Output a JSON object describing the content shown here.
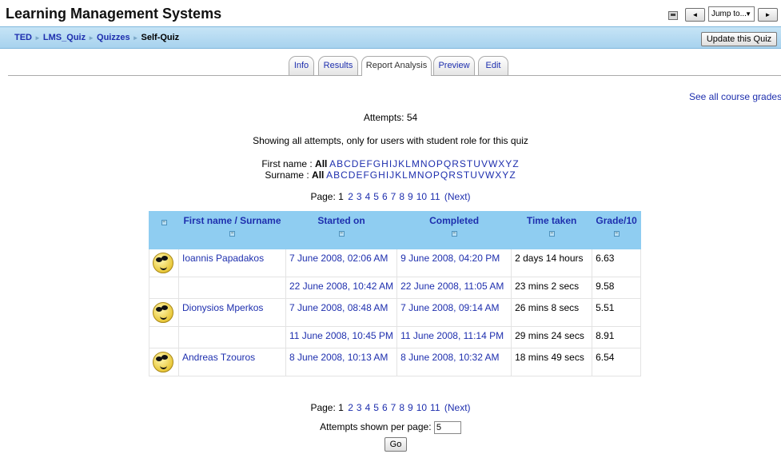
{
  "header": {
    "site_title": "Learning Management Systems",
    "jump_to": "Jump to...",
    "prev_label": "◄",
    "next_label": "►"
  },
  "breadcrumb": {
    "items": [
      "TED",
      "LMS_Quiz",
      "Quizzes"
    ],
    "current": "Self-Quiz"
  },
  "update_button": "Update this Quiz",
  "tabs": [
    {
      "label": "Info",
      "active": false
    },
    {
      "label": "Results",
      "active": false
    },
    {
      "label": "Report Analysis",
      "active": true
    },
    {
      "label": "Preview",
      "active": false
    },
    {
      "label": "Edit",
      "active": false
    }
  ],
  "see_all_link": "See all course grades",
  "attempts_text": "Attempts: 54",
  "showing_text": "Showing all attempts, only for users with student role for this quiz",
  "filters": {
    "first_name_label": "First name :",
    "surname_label": "Surname :",
    "all_label": "All",
    "letters": [
      "A",
      "B",
      "C",
      "D",
      "E",
      "F",
      "G",
      "H",
      "I",
      "J",
      "K",
      "L",
      "M",
      "N",
      "O",
      "P",
      "Q",
      "R",
      "S",
      "T",
      "U",
      "V",
      "W",
      "X",
      "Y",
      "Z"
    ]
  },
  "paging": {
    "label": "Page:",
    "current": "1",
    "pages": [
      "2",
      "3",
      "4",
      "5",
      "6",
      "7",
      "8",
      "9",
      "10",
      "11"
    ],
    "next": "(Next)"
  },
  "table": {
    "columns": [
      "First name / Surname",
      "Started on",
      "Completed",
      "Time taken",
      "Grade/10"
    ],
    "rows": [
      {
        "avatar": true,
        "name": "Ioannis Papadakos",
        "started": "7 June 2008, 02:06 AM",
        "completed": "9 June 2008, 04:20 PM",
        "time": "2 days 14 hours",
        "grade": "6.63"
      },
      {
        "avatar": false,
        "name": "",
        "started": "22 June 2008, 10:42 AM",
        "completed": "22 June 2008, 11:05 AM",
        "time": "23 mins 2 secs",
        "grade": "9.58"
      },
      {
        "avatar": true,
        "name": "Dionysios Mperkos",
        "started": "7 June 2008, 08:48 AM",
        "completed": "7 June 2008, 09:14 AM",
        "time": "26 mins 8 secs",
        "grade": "5.51"
      },
      {
        "avatar": false,
        "name": "",
        "started": "11 June 2008, 10:45 PM",
        "completed": "11 June 2008, 11:14 PM",
        "time": "29 mins 24 secs",
        "grade": "8.91"
      },
      {
        "avatar": true,
        "name": "Andreas Tzouros",
        "started": "8 June 2008, 10:13 AM",
        "completed": "8 June 2008, 10:32 AM",
        "time": "18 mins 49 secs",
        "grade": "6.54"
      }
    ]
  },
  "per_page": {
    "label": "Attempts shown per page:",
    "value": "5",
    "go": "Go"
  }
}
